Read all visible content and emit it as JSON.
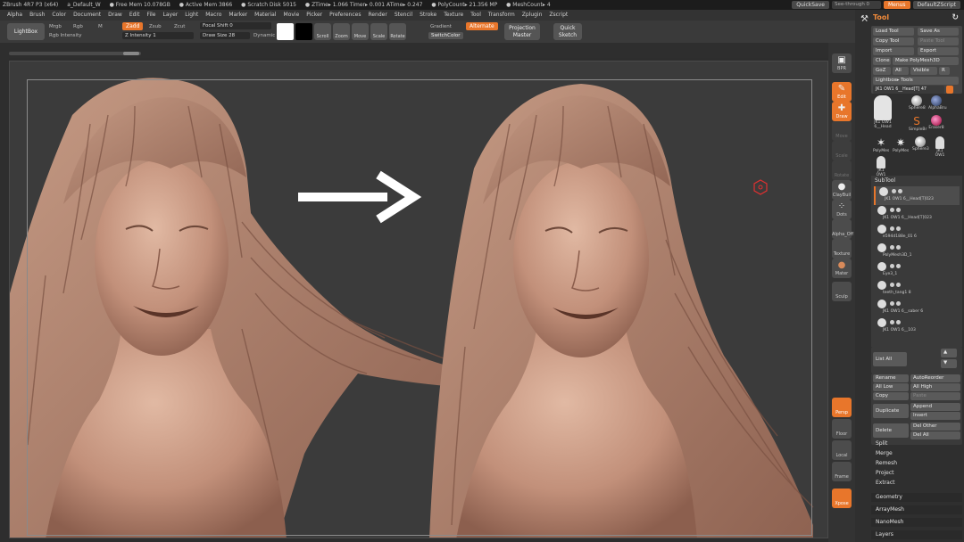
{
  "titlebar": {
    "app": "ZBrush 4R7 P3 (x64)",
    "doc": "a_Default_W",
    "free_mem": "● Free Mem 10.078GB",
    "active_mem": "● Active Mem 3866",
    "scratch": "● Scratch Disk 5015",
    "ztime": "● ZTime▸ 1.066 Timer▸ 0.001 ATime▸ 0.247",
    "poly": "● PolyCount▸ 21.356 MP",
    "mesh": "● MeshCount▸ 4",
    "quicksave": "QuickSave",
    "seethrough": "See-through  0",
    "menus": "Menus",
    "defaultzscript": "DefaultZScript"
  },
  "menubar": [
    "Alpha",
    "Brush",
    "Color",
    "Document",
    "Draw",
    "Edit",
    "File",
    "Layer",
    "Light",
    "Macro",
    "Marker",
    "Material",
    "Movie",
    "Picker",
    "Preferences",
    "Render",
    "Stencil",
    "Stroke",
    "Texture",
    "Tool",
    "Transform",
    "Zplugin",
    "Zscript"
  ],
  "shelf": {
    "lightbox": "LightBox",
    "mrgb": "Mrgb",
    "rgb": "Rgb",
    "m": "M",
    "zadd": "Zadd",
    "zsub": "Zsub",
    "zcut": "Zcut",
    "rgb_intensity": "Rgb Intensity",
    "z_intensity": "Z Intensity  1",
    "focal_shift": "Focal Shift  0",
    "draw_size": "Draw Size  28",
    "dynamic": "Dynamic",
    "scroll": "Scroll",
    "zoom": "Zoom",
    "move": "Move",
    "scale": "Scale",
    "rotate": "Rotate",
    "gradient": "Gradient",
    "switchcolor": "SwitchColor",
    "alternate": "Alternate",
    "projection_master": "Projection Master",
    "quick_sketch": "Quick Sketch",
    "main_color": "#ffffff",
    "secondary_color": "#000000"
  },
  "rshelf": [
    "BPR",
    "Edit",
    "Draw",
    "Move",
    "Scale",
    "Rotate",
    "ClayBuil",
    "Dots",
    "Alpha_Off",
    "Texture",
    "Mater",
    "Sculp",
    "Persp",
    "Floor",
    "Local",
    "Frame",
    "Move",
    "Scale",
    "Rotate",
    "PolyF",
    "Transp",
    "Ghost",
    "Solo",
    "Xpose"
  ],
  "tool": {
    "title": "Tool",
    "load_tool": "Load Tool",
    "save_as": "Save As",
    "copy_tool": "Copy Tool",
    "paste_tool": "Paste Tool",
    "import": "Import",
    "export": "Export",
    "clone": "Clone",
    "make_polymesh": "Make PolyMesh3D",
    "goz": "GoZ",
    "all": "All",
    "visible": "Visible",
    "r": "R",
    "lightbox_tools": "Lightbox▸ Tools",
    "current_tool": "JK1 OW1 6__Head[T] 47",
    "thumbs": [
      {
        "label": "JK1 OW1 6__Head"
      },
      {
        "label": "Sphere8"
      },
      {
        "label": "AlphaBru"
      },
      {
        "label": "SimpleBr"
      },
      {
        "label": "Eraser8"
      },
      {
        "label": "PolyMes"
      },
      {
        "label": "PolyMes"
      },
      {
        "label": "Sphere3"
      },
      {
        "label": "JK1 OW1"
      },
      {
        "label": "JK1 OW1"
      }
    ],
    "subtool_title": "SubTool",
    "subtools": [
      "JK1 OW1 6__Head[T]023",
      "JK1 OW1 6__Head[T]023",
      "e594d188e_01 6",
      "PolyMesh3D_1",
      "Eye3_1",
      "teeth_tang1 8",
      "JK1 OW1 6__saber 6",
      "JK1 OW1 6__103"
    ],
    "list_all": "List  All",
    "rename": "Rename",
    "autoreorder": "AutoReorder",
    "all_low": "All Low",
    "all_high": "All High",
    "copy": "Copy",
    "paste": "Paste",
    "duplicate": "Duplicate",
    "append": "Append",
    "insert": "Insert",
    "delete": "Delete",
    "del_other": "Del Other",
    "del_all": "Del All",
    "split": "Split",
    "merge": "Merge",
    "remesh": "Remesh",
    "project": "Project",
    "extract": "Extract",
    "geometry": "Geometry",
    "arraymesh": "ArrayMesh",
    "nanomesh": "NanoMesh",
    "layers": "Layers"
  },
  "colors": {
    "accent": "#e8762b",
    "skin": "#c49078",
    "hair": "#b58670"
  }
}
